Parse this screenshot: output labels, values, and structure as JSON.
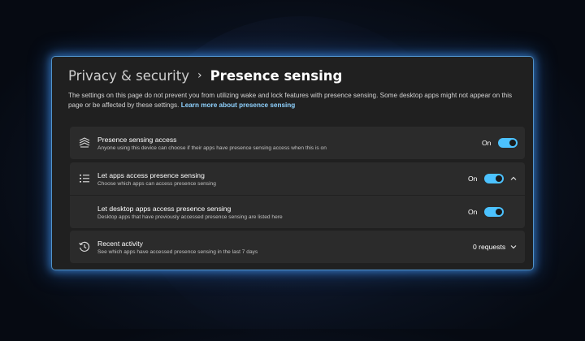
{
  "breadcrumb": {
    "parent": "Privacy & security",
    "separator": "›",
    "current": "Presence sensing"
  },
  "description": {
    "text": "The settings on this page do not prevent you from utilizing wake and lock features with presence sensing. Some desktop apps might not appear on this page or be affected by these settings.",
    "link": "Learn more about presence sensing"
  },
  "rows": [
    {
      "icon": "presence-sensing-icon",
      "title": "Presence sensing access",
      "subtitle": "Anyone using this device can choose if their apps have presence sensing access when this is on",
      "state": "On",
      "toggle_on": true
    },
    {
      "icon": "list-icon",
      "title": "Let apps access presence sensing",
      "subtitle": "Choose which apps can access presence sensing",
      "state": "On",
      "toggle_on": true,
      "expander": "chevron-up-icon"
    },
    {
      "title": "Let desktop apps access presence sensing",
      "subtitle": "Desktop apps that have previously accessed presence sensing are listed here",
      "state": "On",
      "toggle_on": true
    },
    {
      "icon": "history-icon",
      "title": "Recent activity",
      "subtitle": "See which apps have accessed presence sensing in the last 7 days",
      "state": "0 requests",
      "expander": "chevron-down-icon"
    }
  ],
  "colors": {
    "accent": "#4cc2ff",
    "link": "#8fd2ff",
    "card": "#2b2b2b",
    "window": "#202020"
  }
}
